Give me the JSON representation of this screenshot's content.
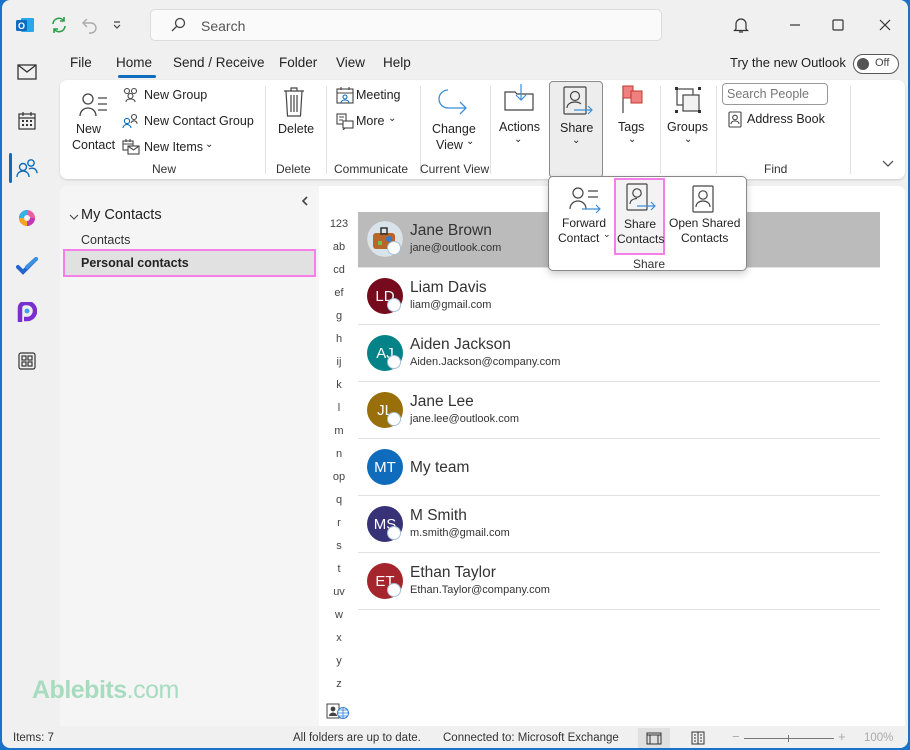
{
  "titlebar": {
    "search_placeholder": "Search",
    "try_new_label": "Try the new Outlook",
    "toggle_state": "Off"
  },
  "menu": {
    "tabs": [
      "File",
      "Home",
      "Send / Receive",
      "Folder",
      "View",
      "Help"
    ],
    "active_tab": "Home"
  },
  "ribbon": {
    "new_group": {
      "new_contact_line1": "New",
      "new_contact_line2": "Contact",
      "new_group": "New Group",
      "new_contact_group": "New Contact Group",
      "new_items": "New Items",
      "label": "New"
    },
    "delete_group": {
      "delete": "Delete",
      "label": "Delete"
    },
    "communicate_group": {
      "meeting": "Meeting",
      "more": "More",
      "label": "Communicate"
    },
    "current_view_group": {
      "change_line1": "Change",
      "change_line2": "View",
      "label": "Current View"
    },
    "actions": "Actions",
    "share": "Share",
    "tags": "Tags",
    "groups": "Groups",
    "find_group": {
      "search_people_placeholder": "Search People",
      "address_book": "Address Book",
      "label": "Find"
    }
  },
  "share_popup": {
    "forward_line1": "Forward",
    "forward_line2": "Contact",
    "share_line1": "Share",
    "share_line2": "Contacts",
    "open_line1": "Open Shared",
    "open_line2": "Contacts",
    "label": "Share"
  },
  "nav": {
    "section": "My Contacts",
    "items": [
      "Contacts",
      "Personal contacts"
    ],
    "selected": "Personal contacts"
  },
  "index": [
    "123",
    "ab",
    "cd",
    "ef",
    "g",
    "h",
    "ij",
    "k",
    "l",
    "m",
    "n",
    "op",
    "q",
    "r",
    "s",
    "t",
    "uv",
    "w",
    "x",
    "y",
    "z"
  ],
  "contacts": [
    {
      "name": "Jane Brown",
      "email": "jane@outlook.com",
      "initials": "",
      "color": "#b06a2c",
      "photo": true,
      "selected": true
    },
    {
      "name": "Liam Davis",
      "email": "liam@gmail.com",
      "initials": "LD",
      "color": "#750b1c"
    },
    {
      "name": "Aiden Jackson",
      "email": "Aiden.Jackson@company.com",
      "initials": "AJ",
      "color": "#038387"
    },
    {
      "name": "Jane Lee",
      "email": "jane.lee@outlook.com",
      "initials": "JL",
      "color": "#986f0b"
    },
    {
      "name": "My team",
      "email": "",
      "initials": "MT",
      "color": "#0f6cbd",
      "group": true
    },
    {
      "name": "M Smith",
      "email": "m.smith@gmail.com",
      "initials": "MS",
      "color": "#373277"
    },
    {
      "name": "Ethan Taylor",
      "email": "Ethan.Taylor@company.com",
      "initials": "ET",
      "color": "#a4262c"
    }
  ],
  "watermark": {
    "brand": "Ablebits",
    "suffix": ".com"
  },
  "status": {
    "items": "Items: 7",
    "sync": "All folders are up to date.",
    "connection": "Connected to: Microsoft Exchange",
    "zoom": "100%"
  },
  "colors": {
    "accent": "#0f6cbd",
    "highlight": "#f47fe9"
  }
}
